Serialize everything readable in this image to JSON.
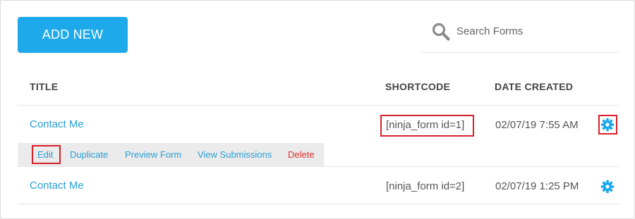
{
  "toolbar": {
    "add_new_label": "ADD NEW"
  },
  "search": {
    "placeholder": "Search Forms",
    "value": ""
  },
  "table": {
    "columns": {
      "title": "TITLE",
      "shortcode": "SHORTCODE",
      "date_created": "DATE CREATED"
    },
    "rows": [
      {
        "title": "Contact Me",
        "shortcode": "[ninja_form id=1]",
        "date_created": "02/07/19 7:55 AM",
        "actions": [
          "Edit",
          "Duplicate",
          "Preview Form",
          "View Submissions",
          "Delete"
        ]
      },
      {
        "title": "Contact Me",
        "shortcode": "[ninja_form id=2]",
        "date_created": "02/07/19 1:25 PM"
      }
    ]
  },
  "icons": {
    "search": "search-icon",
    "settings": "gear-icon"
  },
  "colors": {
    "accent": "#1ea9ea",
    "link": "#2a9ed6",
    "delete": "#e03030",
    "highlight": "#d8202a"
  }
}
